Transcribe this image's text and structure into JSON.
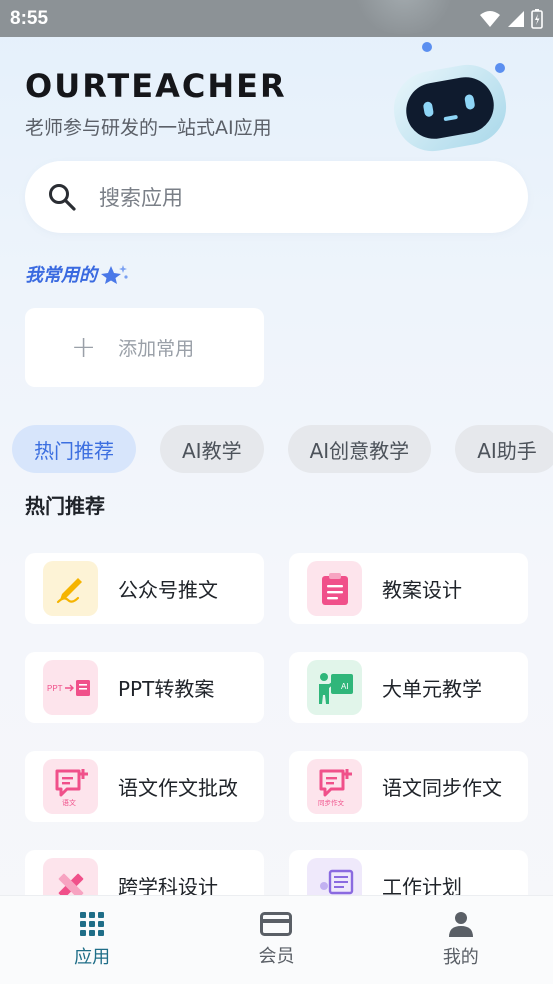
{
  "status_bar": {
    "time": "8:55"
  },
  "header": {
    "brand": "OURTEACHER",
    "subtitle": "老师参与研发的一站式AI应用"
  },
  "search": {
    "placeholder": "搜索应用"
  },
  "favorites": {
    "title": "我常用的",
    "add_label": "添加常用"
  },
  "tabs": [
    {
      "label": "热门推荐",
      "active": true
    },
    {
      "label": "AI教学",
      "active": false
    },
    {
      "label": "AI创意教学",
      "active": false
    },
    {
      "label": "AI助手",
      "active": false
    }
  ],
  "section": {
    "title": "热门推荐"
  },
  "apps": [
    {
      "label": "公众号推文",
      "icon": "pen-writing-icon",
      "color": "#f5b400",
      "bg": "#fdf3d6"
    },
    {
      "label": "教案设计",
      "icon": "clipboard-icon",
      "color": "#f0508a",
      "bg": "#fde4ec"
    },
    {
      "label": "PPT转教案",
      "icon": "ppt-convert-icon",
      "icon_text": "PPT",
      "color": "#f0508a",
      "bg": "#fde4ec"
    },
    {
      "label": "大单元教学",
      "icon": "teacher-board-icon",
      "icon_text": "AI",
      "color": "#2fb67a",
      "bg": "#e1f5ea"
    },
    {
      "label": "语文作文批改",
      "icon": "essay-correct-icon",
      "icon_text": "语文",
      "color": "#f0508a",
      "bg": "#fde4ec"
    },
    {
      "label": "语文同步作文",
      "icon": "essay-sync-icon",
      "icon_text": "同步作文",
      "color": "#f0508a",
      "bg": "#fde4ec"
    },
    {
      "label": "跨学科设计",
      "icon": "ruler-pencil-icon",
      "color": "#f0508a",
      "bg": "#fde4ec"
    },
    {
      "label": "工作计划",
      "icon": "work-plan-icon",
      "color": "#8a6ae0",
      "bg": "#efe9fb"
    }
  ],
  "bottom_nav": [
    {
      "label": "应用",
      "icon": "grid-icon",
      "active": true
    },
    {
      "label": "会员",
      "icon": "card-icon",
      "active": false
    },
    {
      "label": "我的",
      "icon": "person-icon",
      "active": false
    }
  ],
  "colors": {
    "accent": "#3c6fe0",
    "nav_active": "#1f6e88"
  }
}
